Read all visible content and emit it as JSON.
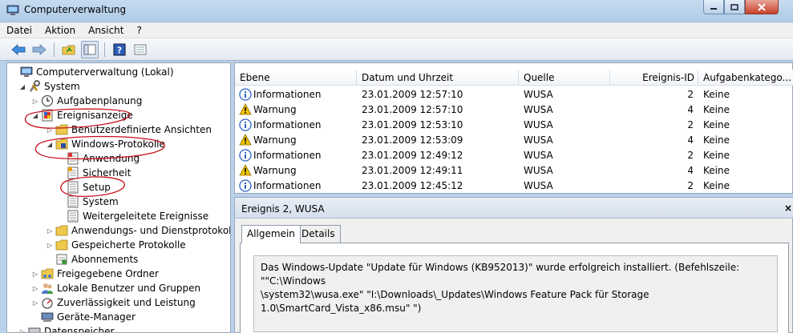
{
  "window": {
    "title": "Computerverwaltung"
  },
  "menu": [
    "Datei",
    "Aktion",
    "Ansicht",
    "?"
  ],
  "toolbar": [
    "back-icon",
    "forward-icon",
    "folder-up-icon",
    "tree-toggle-icon",
    "help-icon",
    "properties-icon"
  ],
  "tree": {
    "root": "Computerverwaltung (Lokal)",
    "system": "System",
    "aufgabenplanung": "Aufgabenplanung",
    "ereignisanzeige": "Ereignisanzeige",
    "benutzerdef": "Benutzerdefinierte Ansichten",
    "winprot": "Windows-Protokolle",
    "anwendung": "Anwendung",
    "sicherheit": "Sicherheit",
    "setup": "Setup",
    "systemlog": "System",
    "weitergeleitet": "Weitergeleitete Ereignisse",
    "anwdienst": "Anwendungs- und Dienstprotokolle",
    "gespeichert": "Gespeicherte Protokolle",
    "abonnements": "Abonnements",
    "freigegeben": "Freigegebene Ordner",
    "lokalebenutzer": "Lokale Benutzer und Gruppen",
    "zuverl": "Zuverlässigkeit und Leistung",
    "geraete": "Geräte-Manager",
    "datenspeicher": "Datenspeicher"
  },
  "columns": {
    "ebene": "Ebene",
    "datum": "Datum und Uhrzeit",
    "quelle": "Quelle",
    "id": "Ereignis-ID",
    "kategorie": "Aufgabenkatego..."
  },
  "events": [
    {
      "ebene": "Informationen",
      "datum": "23.01.2009 12:57:10",
      "quelle": "WUSA",
      "id": "2",
      "kategorie": "Keine",
      "icon": "info-icon"
    },
    {
      "ebene": "Warnung",
      "datum": "23.01.2009 12:57:10",
      "quelle": "WUSA",
      "id": "4",
      "kategorie": "Keine",
      "icon": "warning-icon"
    },
    {
      "ebene": "Informationen",
      "datum": "23.01.2009 12:53:10",
      "quelle": "WUSA",
      "id": "2",
      "kategorie": "Keine",
      "icon": "info-icon"
    },
    {
      "ebene": "Warnung",
      "datum": "23.01.2009 12:53:09",
      "quelle": "WUSA",
      "id": "4",
      "kategorie": "Keine",
      "icon": "warning-icon"
    },
    {
      "ebene": "Informationen",
      "datum": "23.01.2009 12:49:12",
      "quelle": "WUSA",
      "id": "2",
      "kategorie": "Keine",
      "icon": "info-icon"
    },
    {
      "ebene": "Warnung",
      "datum": "23.01.2009 12:49:11",
      "quelle": "WUSA",
      "id": "4",
      "kategorie": "Keine",
      "icon": "warning-icon"
    },
    {
      "ebene": "Informationen",
      "datum": "23.01.2009 12:45:12",
      "quelle": "WUSA",
      "id": "2",
      "kategorie": "Keine",
      "icon": "info-icon"
    }
  ],
  "detail": {
    "title": "Ereignis 2, WUSA",
    "close": "×",
    "tabs": {
      "allgemein": "Allgemein",
      "details": "Details"
    },
    "message_line1": "Das Windows-Update \"Update für Windows (KB952013)\" wurde erfolgreich installiert. (Befehlszeile: \"\"C:\\Windows",
    "message_line2": "\\system32\\wusa.exe\" \"I:\\Downloads\\_Updates\\Windows Feature Pack für Storage 1.0\\SmartCard_Vista_x86.msu\"   \")"
  },
  "colors": {
    "annotation": "#c8101e",
    "titlebar": "#b9d1ea",
    "warning": "#f2c200",
    "info": "#2a62c8"
  }
}
